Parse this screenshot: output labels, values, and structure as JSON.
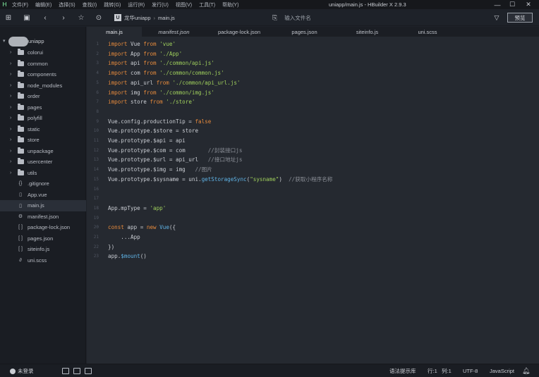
{
  "window": {
    "title": "uniapp/main.js - HBuilder X 2.9.3",
    "minimize_icon": "minimize-icon",
    "maximize_icon": "maximize-icon",
    "close_icon": "close-icon"
  },
  "menu": [
    "文件(F)",
    "编辑(E)",
    "选择(S)",
    "查找(I)",
    "跳转(G)",
    "运行(R)",
    "发行(U)",
    "视图(V)",
    "工具(T)",
    "帮助(Y)"
  ],
  "toolbar": {
    "breadcrumb": [
      "龙华uniapp",
      "main.js"
    ],
    "crumb_sep": "›",
    "crumb_icon_letter": "U",
    "file_search_placeholder": "输入文件名",
    "preview_label": "预览"
  },
  "project": {
    "name": "uniapp",
    "tree": [
      {
        "type": "folder",
        "label": "colorui"
      },
      {
        "type": "folder",
        "label": "common"
      },
      {
        "type": "folder",
        "label": "components"
      },
      {
        "type": "folder",
        "label": "node_modules"
      },
      {
        "type": "folder",
        "label": "order"
      },
      {
        "type": "folder",
        "label": "pages"
      },
      {
        "type": "folder",
        "label": "polyfill"
      },
      {
        "type": "folder",
        "label": "static"
      },
      {
        "type": "folder",
        "label": "store"
      },
      {
        "type": "folder",
        "label": "unpackage"
      },
      {
        "type": "folder",
        "label": "usercenter"
      },
      {
        "type": "folder",
        "label": "utils"
      },
      {
        "type": "file",
        "icon": "{}",
        "label": ".gitignore"
      },
      {
        "type": "file",
        "icon": "▯",
        "label": "App.vue"
      },
      {
        "type": "file",
        "icon": "▯",
        "label": "main.js",
        "active": true
      },
      {
        "type": "file",
        "icon": "⚙",
        "label": "manifest.json"
      },
      {
        "type": "file",
        "icon": "[ ]",
        "label": "package-lock.json"
      },
      {
        "type": "file",
        "icon": "[ ]",
        "label": "pages.json"
      },
      {
        "type": "file",
        "icon": "[ ]",
        "label": "siteinfo.js"
      },
      {
        "type": "file",
        "icon": "∂",
        "label": "uni.scss"
      }
    ]
  },
  "tabs": [
    {
      "label": "main.js",
      "active": true,
      "italic": false
    },
    {
      "label": "manifest.json",
      "active": false,
      "italic": true
    },
    {
      "label": "package-lock.json",
      "active": false,
      "italic": false
    },
    {
      "label": "pages.json",
      "active": false,
      "italic": false
    },
    {
      "label": "siteinfo.js",
      "active": false,
      "italic": false
    },
    {
      "label": "uni.scss",
      "active": false,
      "italic": false
    }
  ],
  "code_lines": [
    [
      [
        "kw",
        "import"
      ],
      [
        "plain",
        " Vue "
      ],
      [
        "kw",
        "from"
      ],
      [
        "plain",
        " "
      ],
      [
        "str",
        "'vue'"
      ]
    ],
    [
      [
        "kw",
        "import"
      ],
      [
        "plain",
        " App "
      ],
      [
        "kw",
        "from"
      ],
      [
        "plain",
        " "
      ],
      [
        "str",
        "'./App'"
      ]
    ],
    [
      [
        "kw",
        "import"
      ],
      [
        "plain",
        " api "
      ],
      [
        "kw",
        "from"
      ],
      [
        "plain",
        " "
      ],
      [
        "str",
        "'./common/api.js'"
      ]
    ],
    [
      [
        "kw",
        "import"
      ],
      [
        "plain",
        " com "
      ],
      [
        "kw",
        "from"
      ],
      [
        "plain",
        " "
      ],
      [
        "str",
        "'./common/common.js'"
      ]
    ],
    [
      [
        "kw",
        "import"
      ],
      [
        "plain",
        " api_url "
      ],
      [
        "kw",
        "from"
      ],
      [
        "plain",
        " "
      ],
      [
        "str",
        "'./common/api_url.js'"
      ]
    ],
    [
      [
        "kw",
        "import"
      ],
      [
        "plain",
        " img "
      ],
      [
        "kw",
        "from"
      ],
      [
        "plain",
        " "
      ],
      [
        "str",
        "'./common/img.js'"
      ]
    ],
    [
      [
        "kw",
        "import"
      ],
      [
        "plain",
        " store "
      ],
      [
        "kw",
        "from"
      ],
      [
        "plain",
        " "
      ],
      [
        "str",
        "'./store'"
      ]
    ],
    [],
    [
      [
        "plain",
        "Vue.config.productionTip = "
      ],
      [
        "kw",
        "false"
      ]
    ],
    [
      [
        "plain",
        "Vue.prototype.$store = store"
      ]
    ],
    [
      [
        "plain",
        "Vue.prototype.$api = api"
      ]
    ],
    [
      [
        "plain",
        "Vue.prototype.$com = com       "
      ],
      [
        "cmt",
        "//封装接口js"
      ]
    ],
    [
      [
        "plain",
        "Vue.prototype.$url = api_url   "
      ],
      [
        "cmt",
        "//接口地址js"
      ]
    ],
    [
      [
        "plain",
        "Vue.prototype.$img = img   "
      ],
      [
        "cmt",
        "//图片"
      ]
    ],
    [
      [
        "plain",
        "Vue.prototype.$sysname = uni."
      ],
      [
        "fn",
        "getStorageSync"
      ],
      [
        "plain",
        "("
      ],
      [
        "str",
        "\"sysname\""
      ],
      [
        "plain",
        ")  "
      ],
      [
        "cmt",
        "//获取小程序名称"
      ]
    ],
    [],
    [],
    [
      [
        "plain",
        "App.mpType = "
      ],
      [
        "str",
        "'app'"
      ]
    ],
    [],
    [
      [
        "kw",
        "const"
      ],
      [
        "plain",
        " app = "
      ],
      [
        "kw",
        "new"
      ],
      [
        "plain",
        " "
      ],
      [
        "fn",
        "Vue"
      ],
      [
        "plain",
        "({"
      ]
    ],
    [
      [
        "plain",
        "    ...App"
      ]
    ],
    [
      [
        "plain",
        "})"
      ]
    ],
    [
      [
        "plain",
        "app."
      ],
      [
        "fn",
        "$mount"
      ],
      [
        "plain",
        "()"
      ]
    ]
  ],
  "status": {
    "login": "未登录",
    "syntax_lib": "语法提示库",
    "row": "行:1",
    "col": "列:1",
    "encoding": "UTF-8",
    "language": "JavaScript"
  }
}
